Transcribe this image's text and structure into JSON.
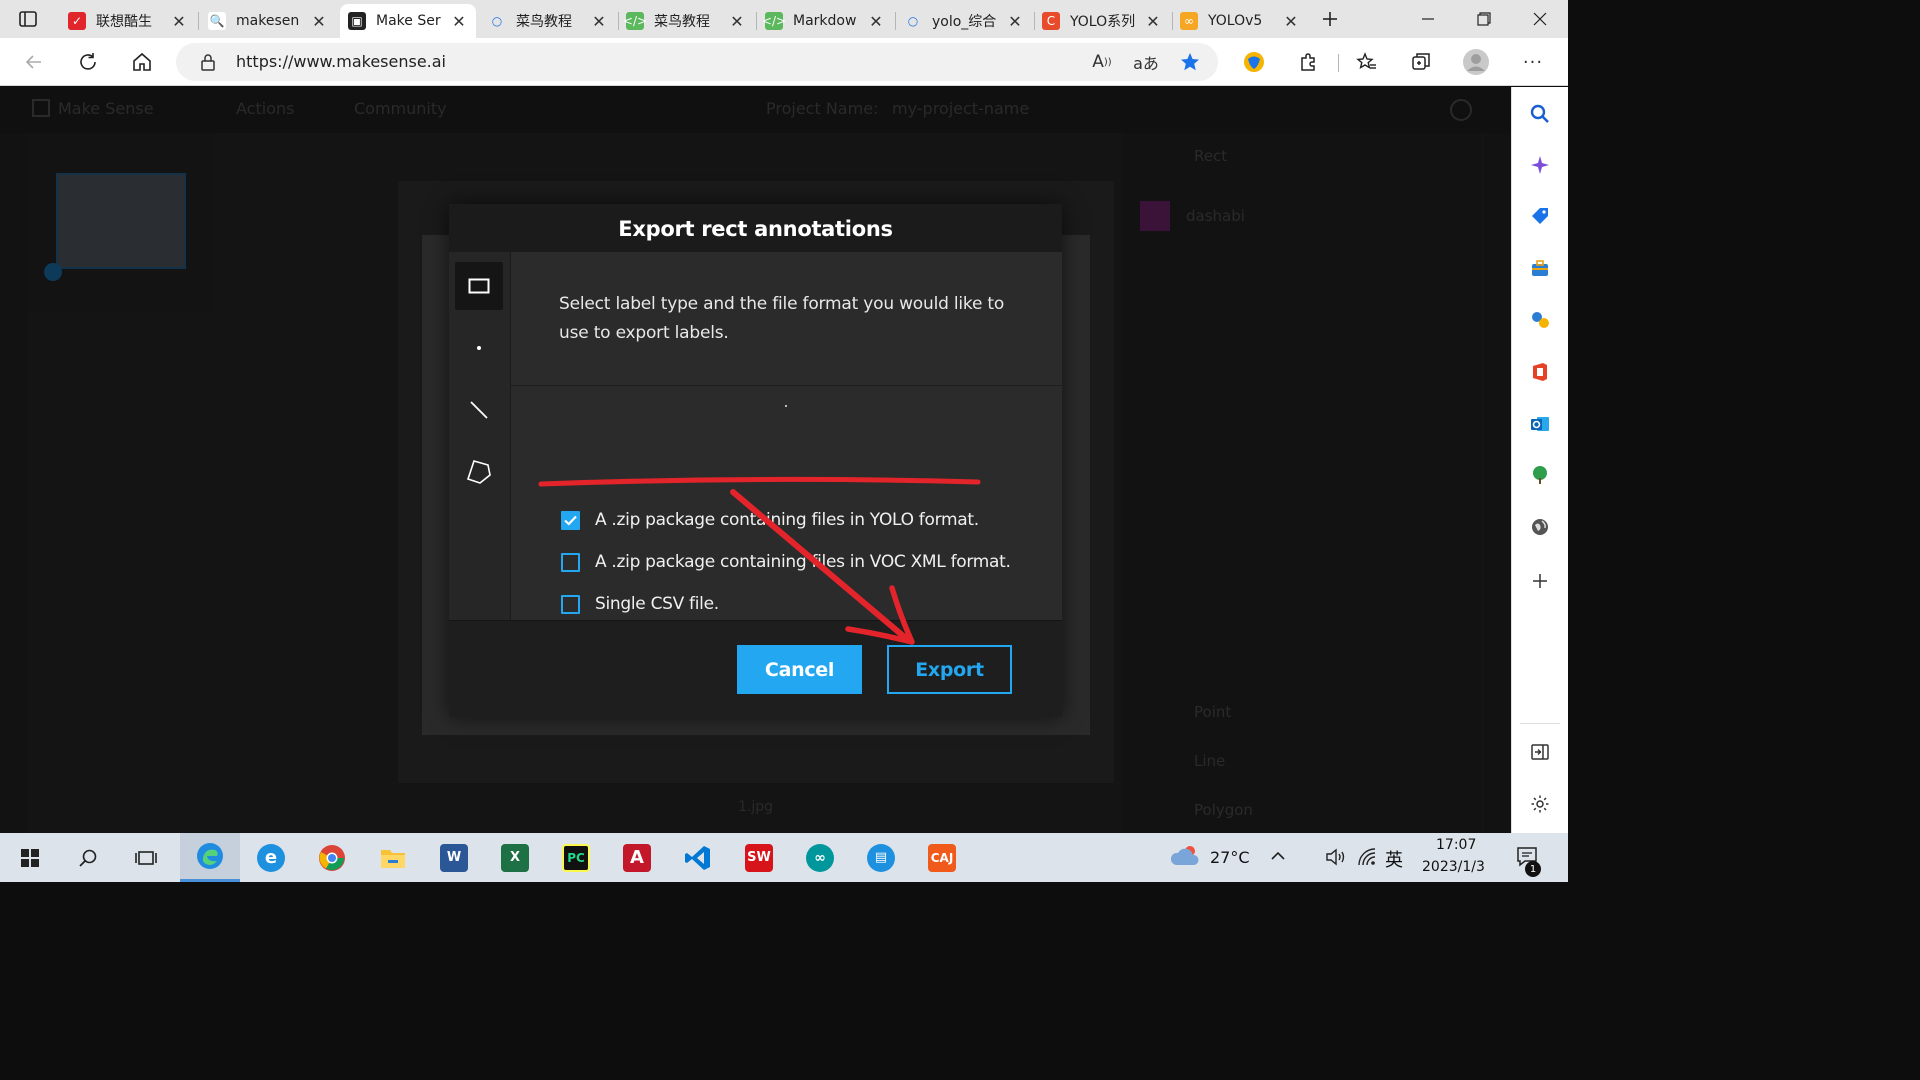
{
  "browser": {
    "tabs": [
      {
        "title": "联想酷生",
        "fav_color": "#e0262b",
        "fav_glyph": "✓"
      },
      {
        "title": "makesen",
        "fav_color": "#ffffff",
        "fav_glyph": "🔍"
      },
      {
        "title": "Make Ser",
        "fav_color": "#222222",
        "fav_glyph": "▣",
        "active": true
      },
      {
        "title": "菜鸟教程",
        "fav_color": "#e5e5e5",
        "fav_glyph": "○"
      },
      {
        "title": "菜鸟教程",
        "fav_color": "#5cb85c",
        "fav_glyph": "</>"
      },
      {
        "title": "Markdow",
        "fav_color": "#5cb85c",
        "fav_glyph": "</>"
      },
      {
        "title": "yolo_综合",
        "fav_color": "#e5e5e5",
        "fav_glyph": "○"
      },
      {
        "title": "YOLO系列",
        "fav_color": "#e84a2c",
        "fav_glyph": "C"
      },
      {
        "title": "YOLOv5",
        "fav_color": "#f5a623",
        "fav_glyph": "∞"
      }
    ],
    "url": "https://www.makesense.ai"
  },
  "app": {
    "brand": "Make Sense",
    "menu": [
      "Actions",
      "Community"
    ],
    "project_label": "Project Name:",
    "project_name": "my-project-name",
    "label_panel": {
      "rect_title": "Rect",
      "label_name": "dashabi",
      "point_title": "Point",
      "line_title": "Line",
      "polygon_title": "Polygon"
    },
    "footer_file": "1.jpg"
  },
  "modal": {
    "title": "Export rect annotations",
    "description": "Select label type and the file format you would like to use to export labels.",
    "options": [
      {
        "label": "A .zip package containing files in YOLO format.",
        "checked": true
      },
      {
        "label": "A .zip package containing files in VOC XML format.",
        "checked": false
      },
      {
        "label": "Single CSV file.",
        "checked": false
      }
    ],
    "cancel_label": "Cancel",
    "export_label": "Export"
  },
  "taskbar": {
    "weather": "27°C",
    "ime": "英",
    "time": "17:07",
    "date": "2023/1/3",
    "notif_count": "1"
  },
  "colors": {
    "accent": "#22a7f0",
    "annotation_red": "#e3242b"
  }
}
